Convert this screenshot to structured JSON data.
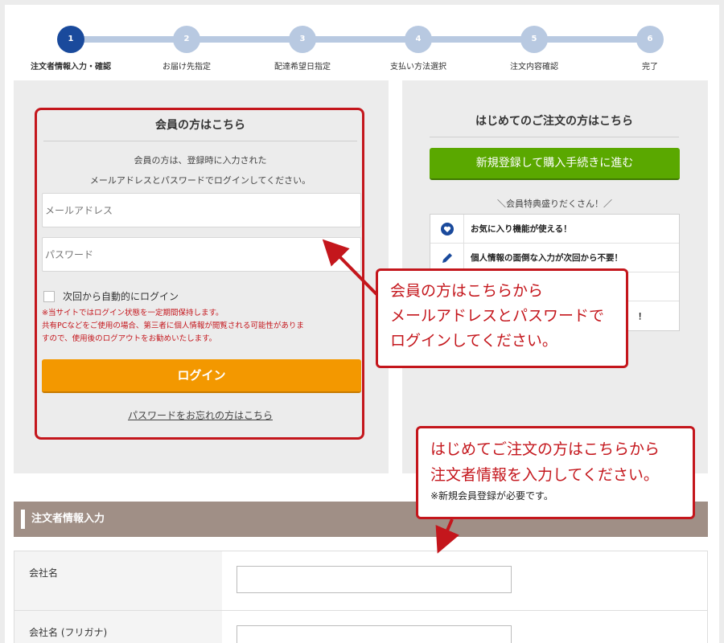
{
  "steps": [
    {
      "num": "1",
      "label": "注文者情報入力・確認",
      "active": true
    },
    {
      "num": "2",
      "label": "お届け先指定",
      "active": false
    },
    {
      "num": "3",
      "label": "配達希望日指定",
      "active": false
    },
    {
      "num": "4",
      "label": "支払い方法選択",
      "active": false
    },
    {
      "num": "5",
      "label": "注文内容確認",
      "active": false
    },
    {
      "num": "6",
      "label": "完了",
      "active": false
    }
  ],
  "login": {
    "title": "会員の方はこちら",
    "desc_line1": "会員の方は、登録時に入力された",
    "desc_line2": "メールアドレスとパスワードでログインしてください。",
    "email_placeholder": "メールアドレス",
    "password_placeholder": "パスワード",
    "remember_label": "次回から自動的にログイン",
    "note_line1": "※当サイトではログイン状態を一定期間保持します。",
    "note_line2": "共有PCなどをご使用の場合、第三者に個人情報が閲覧される可能性がありま",
    "note_line3": "すので、使用後のログアウトをお勧めいたします。",
    "button_label": "ログイン",
    "forgot_link": "パスワードをお忘れの方はこちら"
  },
  "new_customer": {
    "title": "はじめてのご注文の方はこちら",
    "register_button": "新規登録して購入手続きに進む",
    "perks_heading": "＼会員特典盛りだくさん！／",
    "perks": [
      {
        "icon": "heart-icon",
        "text": "お気に入り機能が使える！"
      },
      {
        "icon": "pencil-icon",
        "text": "個人情報の面倒な入力が次回から不要！"
      },
      {
        "icon": "",
        "text": ""
      },
      {
        "icon": "",
        "text": "！"
      }
    ]
  },
  "callouts": {
    "login_line1": "会員の方はこちらから",
    "login_line2": "メールアドレスとパスワードで",
    "login_line3": "ログインしてください。",
    "order_line1": "はじめてご注文の方はこちらから",
    "order_line2": "注文者情報を入力してください。",
    "order_note": "※新規会員登録が必要です。"
  },
  "section": {
    "title": "注文者情報入力",
    "rows": [
      {
        "label": "会社名"
      },
      {
        "label": "会社名 (フリガナ)"
      }
    ]
  },
  "colors": {
    "accent_red": "#c4161c",
    "login_orange": "#f39800",
    "register_green": "#5aa800",
    "step_active": "#1a4a9c",
    "step_inactive": "#b8c9e1",
    "section_bar": "#a08f86"
  }
}
